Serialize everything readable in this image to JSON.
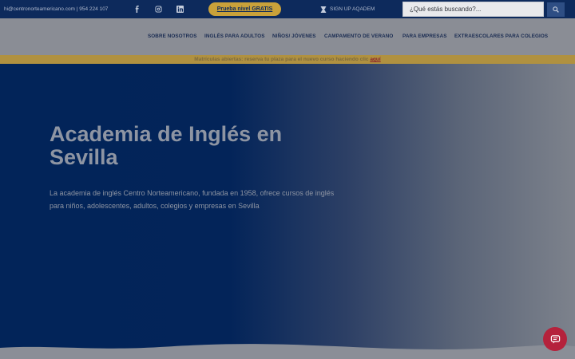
{
  "topbar": {
    "contact": "hi@centronorteamericano.com | 954 224 107",
    "social": [
      "facebook-icon",
      "instagram-icon",
      "linkedin-icon"
    ],
    "cta_label": "Prueba nivel GRATIS",
    "signup_label": "SIGN UP AQADEM",
    "search_placeholder": "¿Qué estás buscando?..."
  },
  "nav": {
    "items": [
      "SOBRE NOSOTROS",
      "INGLÉS PARA ADULTOS",
      "NIÑOS/ JÓVENES",
      "CAMPAMENTO DE VERANO",
      "PARA EMPRESAS",
      "EXTRAESCOLARES PARA COLEGIOS"
    ]
  },
  "announce": {
    "text": "Matrículas abiertas: reserva tu plaza para el nuevo curso haciendo clic ",
    "link": "aquí"
  },
  "hero": {
    "title": "Academia de Inglés en Sevilla",
    "description": "La academia de inglés Centro Norteamericano, fundada en 1958, ofrece cursos de inglés para niños, adolescentes, adultos, colegios y empresas en Sevilla"
  },
  "colors": {
    "topbar": "#0d2a5c",
    "accent": "#c9a13a",
    "hero_dark": "#022459",
    "chat": "#b5223c"
  }
}
